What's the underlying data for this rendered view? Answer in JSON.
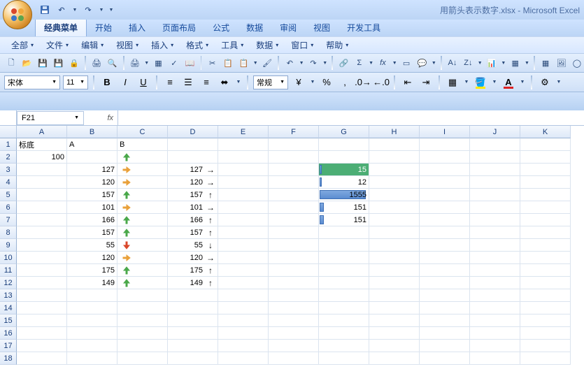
{
  "app": {
    "title": "用箭头表示数字.xlsx - Microsoft Excel"
  },
  "tabs": {
    "classic": "经典菜单",
    "home": "开始",
    "insert": "插入",
    "layout": "页面布局",
    "formulas": "公式",
    "data": "数据",
    "review": "审阅",
    "view": "视图",
    "dev": "开发工具"
  },
  "menus": {
    "all": "全部",
    "file": "文件",
    "edit": "编辑",
    "view": "视图",
    "insert": "插入",
    "format": "格式",
    "tools": "工具",
    "data": "数据",
    "window": "窗口",
    "help": "帮助"
  },
  "format": {
    "font": "宋体",
    "size": "11",
    "numStyle": "常规"
  },
  "namebox": "F21",
  "columns": [
    "A",
    "B",
    "C",
    "D",
    "E",
    "F",
    "G",
    "H",
    "I",
    "J",
    "K"
  ],
  "cells": {
    "A1": "标底",
    "B1": "A",
    "C1": "B",
    "A2": "100",
    "B3": "127",
    "B4": "120",
    "B5": "157",
    "B6": "101",
    "B7": "166",
    "B8": "157",
    "B9": "55",
    "B10": "120",
    "B11": "175",
    "B12": "149",
    "D3": "127",
    "D4": "120",
    "D5": "157",
    "D6": "101",
    "D7": "166",
    "D8": "157",
    "D9": "55",
    "D10": "120",
    "D11": "175",
    "D12": "149",
    "G3": "15",
    "G4": "12",
    "G5": "1555",
    "G6": "151",
    "G7": "151"
  },
  "iconC": {
    "2": "up-g",
    "3": "right-y",
    "4": "right-y",
    "5": "up-g",
    "6": "right-y",
    "7": "up-g",
    "8": "up-g",
    "9": "down-r",
    "10": "right-y",
    "11": "up-g",
    "12": "up-g"
  },
  "arrowD": {
    "3": "→",
    "4": "→",
    "5": "↑",
    "6": "→",
    "7": "↑",
    "8": "↑",
    "9": "↓",
    "10": "→",
    "11": "↑",
    "12": "↑"
  },
  "chart_data": {
    "type": "bar",
    "title": "Column G data bars",
    "categories": [
      "Row3",
      "Row4",
      "Row5",
      "Row6",
      "Row7"
    ],
    "values": [
      15,
      12,
      1555,
      151,
      151
    ],
    "xlabel": "",
    "ylabel": "",
    "ylim": [
      0,
      1555
    ]
  }
}
